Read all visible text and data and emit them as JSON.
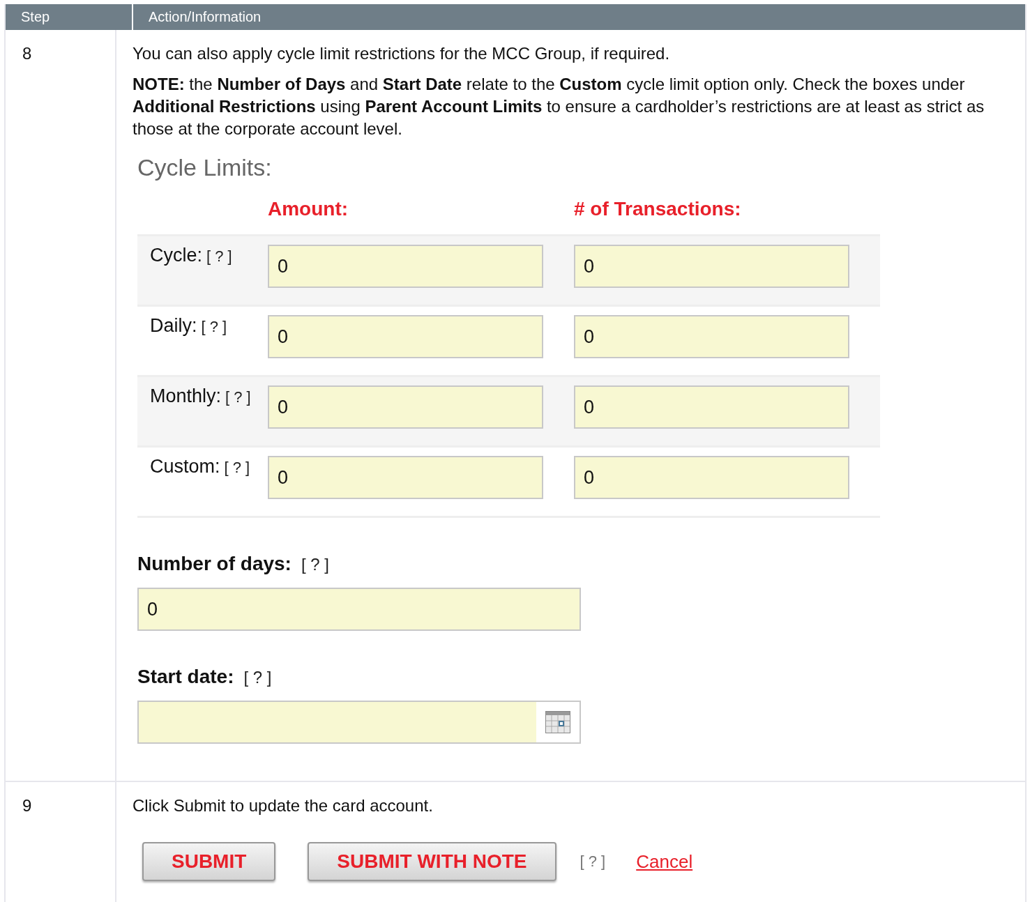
{
  "table": {
    "columns": [
      "Step",
      "Action/Information"
    ]
  },
  "step_8": {
    "number": "8",
    "intro": "You can also apply cycle limit restrictions for the MCC Group, if required.",
    "note": "**NOTE:** the **Number of Days** and **Start Date** relate to the **Custom** cycle limit option only. Check the boxes under **Additional Restrictions** using **Parent Account Limits** to ensure a cardholder’s restrictions are at least as strict as those at the corporate account level.",
    "section_title": "Cycle Limits:",
    "limits": {
      "columns": [
        "Amount:",
        "# of Transactions:"
      ],
      "rows": [
        {
          "label": "Cycle:",
          "help": "[ ? ]",
          "amount": "0",
          "transactions": "0"
        },
        {
          "label": "Daily:",
          "help": "[ ? ]",
          "amount": "0",
          "transactions": "0"
        },
        {
          "label": "Monthly:",
          "help": "[ ? ]",
          "amount": "0",
          "transactions": "0"
        },
        {
          "label": "Custom:",
          "help": "[ ? ]",
          "amount": "0",
          "transactions": "0"
        }
      ]
    },
    "number_of_days": {
      "label": "Number of days:",
      "help": "[ ? ]",
      "value": "0"
    },
    "start_date": {
      "label": "Start date:",
      "help": "[ ? ]"
    }
  },
  "step_9": {
    "number": "9",
    "text": "Click Submit to update the card account.",
    "buttons": [
      "SUBMIT",
      "SUBMIT WITH NOTE"
    ],
    "help": "[ ? ]",
    "cancel": "Cancel"
  }
}
